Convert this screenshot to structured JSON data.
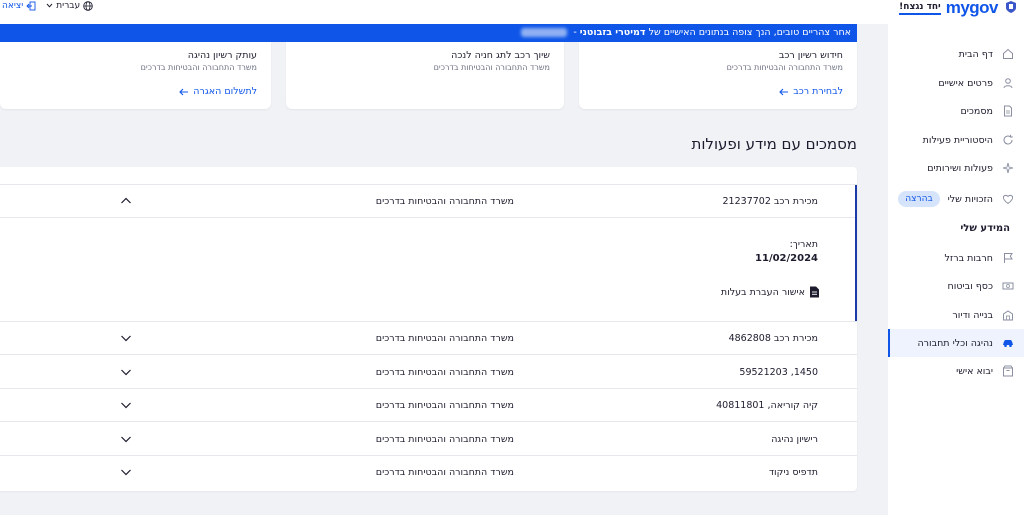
{
  "header": {
    "logo_text": "mygov",
    "logo_tagline": "יחד נגצח!",
    "language_label": "עברית",
    "exit_label": "יציאה"
  },
  "banner": {
    "text_prefix": "אחר צהריים טובים, הנך צופה בנתונים האישיים של",
    "user_name": "דמיטרי בזבוטני",
    "separator": "-"
  },
  "sidebar": {
    "items": [
      {
        "label": "דף הבית",
        "icon": "home-icon"
      },
      {
        "label": "פרטים אישיים",
        "icon": "user-icon"
      },
      {
        "label": "מסמכים",
        "icon": "document-icon"
      },
      {
        "label": "היסטוריית פעילות",
        "icon": "history-icon"
      },
      {
        "label": "פעולות ושירותים",
        "icon": "sparkle-icon"
      },
      {
        "label": "הזכויות שלי",
        "icon": "heart-icon",
        "badge": "בהרצה"
      }
    ],
    "section_title": "המידע שלי",
    "info_items": [
      {
        "label": "חרבות ברזל",
        "icon": "flag-icon"
      },
      {
        "label": "כסף וביטוח",
        "icon": "money-icon"
      },
      {
        "label": "בנייה ודיור",
        "icon": "building-icon"
      },
      {
        "label": "נהיגה וכלי תחבורה",
        "icon": "car-icon",
        "active": true
      },
      {
        "label": "יבוא אישי",
        "icon": "package-icon"
      }
    ]
  },
  "cards": [
    {
      "title": "חידוש רשיון רכב",
      "subtitle": "משרד התחבורה והבטיחות בדרכים",
      "link": "לבחירת רכב"
    },
    {
      "title": "שיוך רכב לתג חניה לנכה",
      "subtitle": "משרד התחבורה והבטיחות בדרכים",
      "link": ""
    },
    {
      "title": "עותק רשיון נהיגה",
      "subtitle": "משרד התחבורה והבטיחות בדרכים",
      "link": "לתשלום האגרה"
    }
  ],
  "section": {
    "title": "מסמכים עם מידע ופעולות"
  },
  "documents": {
    "rows": [
      {
        "name": "מכירת רכב 21237702",
        "office": "משרד התחבורה והבטיחות בדרכים",
        "expanded": true
      },
      {
        "name": "מכירת רכב 4862808",
        "office": "משרד התחבורה והבטיחות בדרכים"
      },
      {
        "name": "1450, 59521203",
        "office": "משרד התחבורה והבטיחות בדרכים"
      },
      {
        "name": "קיה קוריאה, 40811801",
        "office": "משרד התחבורה והבטיחות בדרכים"
      },
      {
        "name": "רישיון נהיגה",
        "office": "משרד התחבורה והבטיחות בדרכים"
      },
      {
        "name": "תדפיס ניקוד",
        "office": "משרד התחבורה והבטיחות בדרכים"
      }
    ],
    "expanded_detail": {
      "date_label": "תאריך:",
      "date_value": "11/02/2024",
      "doc_link": "אישור העברת בעלות"
    }
  },
  "colors": {
    "primary": "#0f56e8",
    "banner": "#0f56e8",
    "background": "#f1f2f6"
  }
}
